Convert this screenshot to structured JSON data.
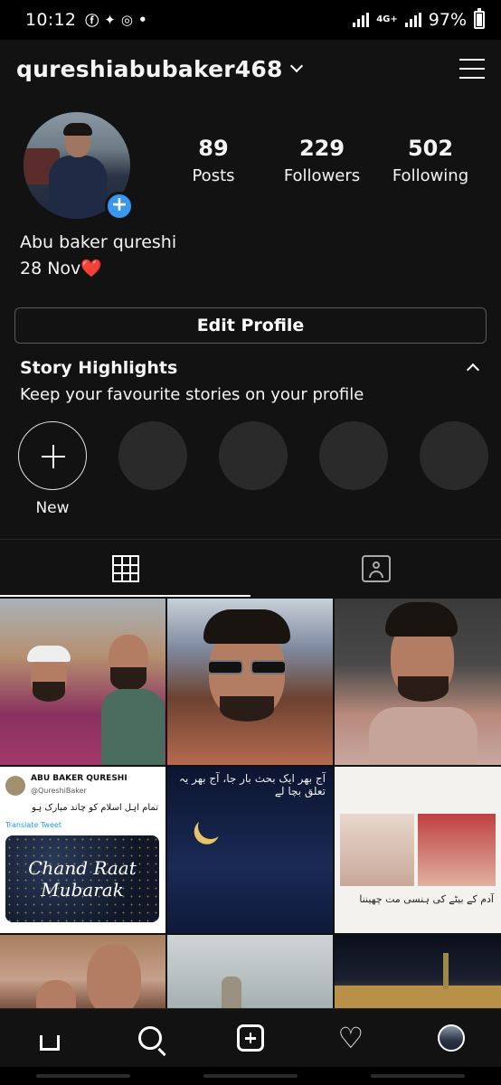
{
  "status_bar": {
    "time": "10:12",
    "network": "4G+",
    "battery": "97%"
  },
  "header": {
    "username": "qureshiabubaker468"
  },
  "profile": {
    "stats": [
      {
        "value": "89",
        "label": "Posts"
      },
      {
        "value": "229",
        "label": "Followers"
      },
      {
        "value": "502",
        "label": "Following"
      }
    ],
    "name": "Abu baker qureshi",
    "bio_line": "28 Nov❤️",
    "edit_profile_label": "Edit Profile"
  },
  "highlights": {
    "title": "Story Highlights",
    "subtitle": "Keep your favourite stories on your profile",
    "new_label": "New"
  },
  "posts": {
    "tweet": {
      "name": "ABU BAKER QURESHI",
      "handle": "@QureshiBaker",
      "body": "تمام اہل اسلام کو چاند مبارک ہو",
      "translate": "Translate Tweet",
      "card_text": "Chand Raat Mubarak"
    },
    "night_text": "آج بھر ایک بحث بار جا، آج بھر یہ تعلق بچا لے",
    "poetry_text": "آدم کے بیٹے کی ہنسی مت چھیننا"
  },
  "colors": {
    "background": "#121212",
    "accent": "#3897f0"
  }
}
